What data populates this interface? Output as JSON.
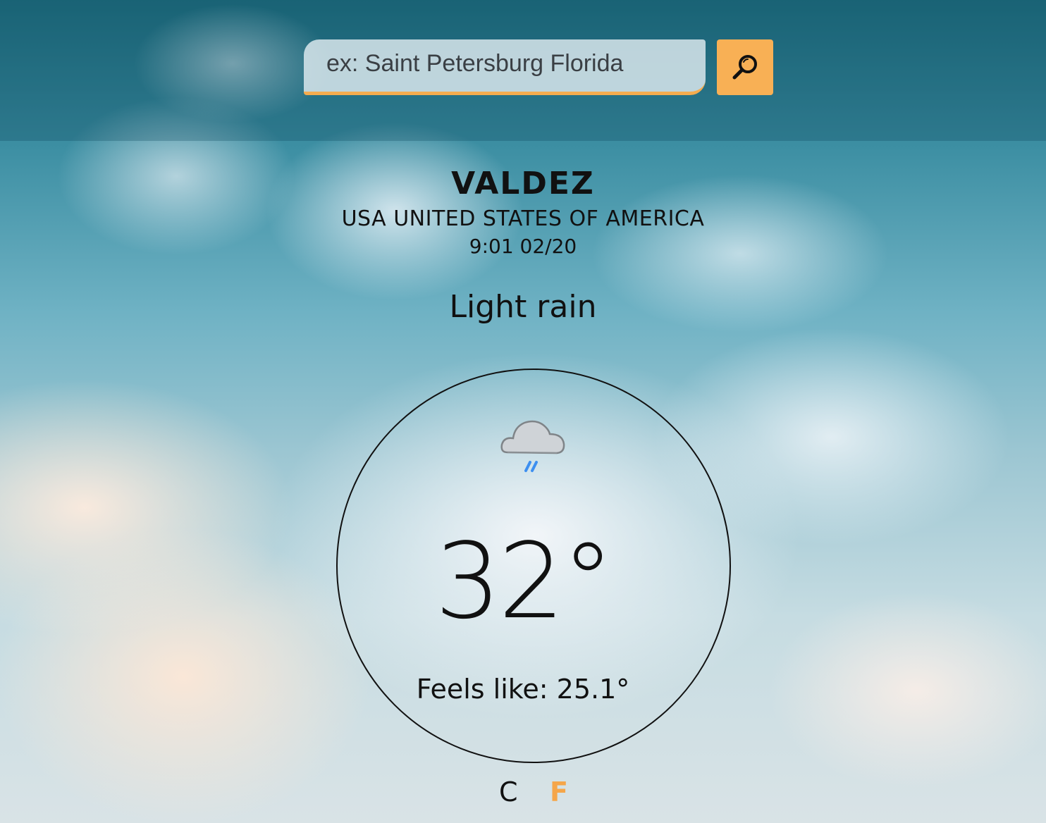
{
  "search": {
    "placeholder": "ex: Saint Petersburg Florida",
    "button_icon": "search-icon"
  },
  "location": {
    "city": "VALDEZ",
    "country": "USA UNITED STATES OF AMERICA",
    "datetime": "9:01 02/20"
  },
  "weather": {
    "condition": "Light rain",
    "icon": "light-rain-icon",
    "temperature": "32°",
    "feels_like": "Feels like: 25.1°"
  },
  "units": {
    "celsius": "C",
    "fahrenheit": "F",
    "selected": "F"
  },
  "colors": {
    "accent": "#f5ac4f",
    "rain": "#3d8ff0"
  }
}
